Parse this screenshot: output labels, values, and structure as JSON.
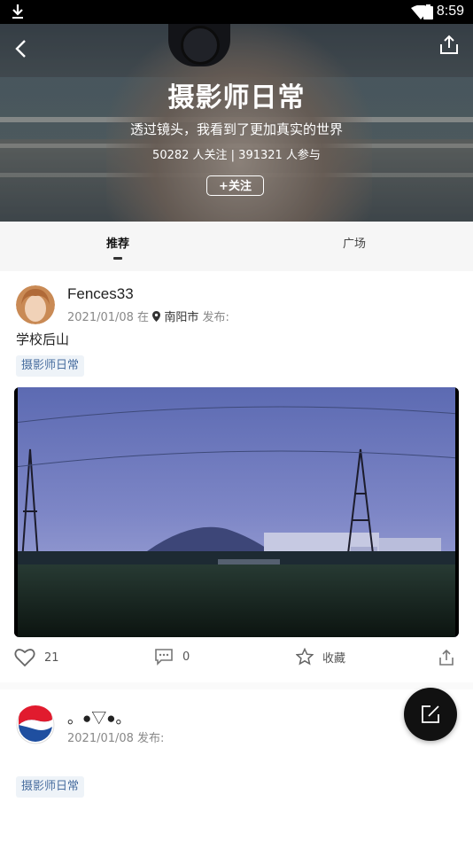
{
  "status_bar": {
    "time": "8:59"
  },
  "header": {
    "title": "摄影师日常",
    "subtitle": "透过镜头，我看到了更加真实的世界",
    "stats": "50282 人关注 | 391321 人参与",
    "follow_label": "+关注"
  },
  "tabs": [
    {
      "label": "推荐",
      "active": true
    },
    {
      "label": "广场",
      "active": false
    }
  ],
  "posts": [
    {
      "author": "Fences33",
      "date": "2021/01/08 在",
      "location": "南阳市",
      "publish_suffix": "发布:",
      "content": "学校后山",
      "tag": "摄影师日常",
      "likes": "21",
      "comments": "0",
      "favorite_label": "收藏"
    },
    {
      "author": "。●▽●。",
      "date": "2021/01/08 发布:",
      "tag": "摄影师日常"
    }
  ],
  "colors": {
    "accent_tag": "#4a6fa0",
    "tag_bg": "#eef3f8",
    "fab": "#111111"
  },
  "icons": [
    "download-icon",
    "wifi-icon",
    "battery-icon",
    "back-icon",
    "share-icon",
    "location-pin-icon",
    "heart-icon",
    "comment-icon",
    "star-icon",
    "share-icon",
    "edit-icon"
  ]
}
